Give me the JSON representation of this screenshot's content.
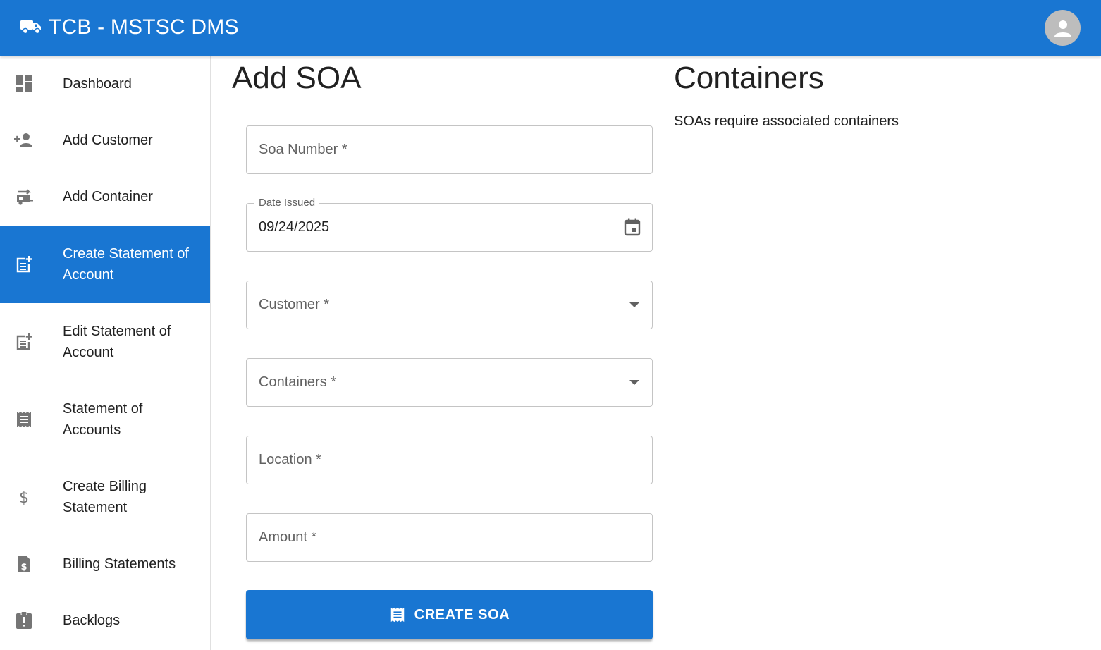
{
  "app": {
    "title": "TCB - MSTSC DMS",
    "brand_color": "#1976d2"
  },
  "sidebar": {
    "items": [
      {
        "label": "Dashboard",
        "icon": "dashboard-icon",
        "active": false
      },
      {
        "label": "Add Customer",
        "icon": "person-add-icon",
        "active": false
      },
      {
        "label": "Add Container",
        "icon": "rv-hookup-icon",
        "active": false
      },
      {
        "label": "Create Statement of Account",
        "icon": "post-add-icon",
        "active": true
      },
      {
        "label": "Edit Statement of Account",
        "icon": "post-add-icon",
        "active": false
      },
      {
        "label": "Statement of Accounts",
        "icon": "receipt-icon",
        "active": false
      },
      {
        "label": "Create Billing Statement",
        "icon": "dollar-icon",
        "active": false
      },
      {
        "label": "Billing Statements",
        "icon": "request-quote-icon",
        "active": false
      },
      {
        "label": "Backlogs",
        "icon": "assignment-late-icon",
        "active": false
      }
    ]
  },
  "form": {
    "heading": "Add SOA",
    "soa_number": {
      "placeholder": "Soa Number *",
      "value": ""
    },
    "date_issued": {
      "label": "Date Issued",
      "value": "09/24/2025"
    },
    "customer": {
      "placeholder": "Customer *",
      "value": ""
    },
    "containers": {
      "placeholder": "Containers *",
      "value": ""
    },
    "location": {
      "placeholder": "Location *",
      "value": ""
    },
    "amount": {
      "placeholder": "Amount *",
      "value": ""
    },
    "submit_label": "CREATE SOA"
  },
  "containers_panel": {
    "heading": "Containers",
    "note": "SOAs require associated containers"
  }
}
